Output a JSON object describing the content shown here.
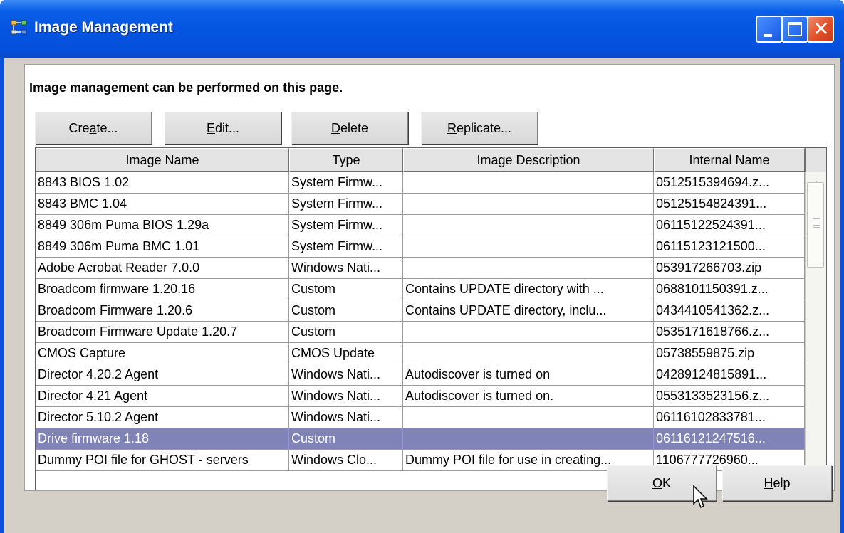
{
  "window": {
    "title": "Image Management"
  },
  "page": {
    "intro": "Image management can be performed on this page."
  },
  "toolbar": {
    "create": {
      "pre": "Cre",
      "mn": "a",
      "post": "te..."
    },
    "edit": {
      "pre": "",
      "mn": "E",
      "post": "dit..."
    },
    "delete": {
      "pre": "",
      "mn": "D",
      "post": "elete"
    },
    "replicate": {
      "pre": "",
      "mn": "R",
      "post": "eplicate..."
    }
  },
  "table": {
    "columns": [
      "Image Name",
      "Type",
      "Image Description",
      "Internal Name"
    ],
    "rows": [
      {
        "name": "8843 BIOS 1.02",
        "type": "System Firmw...",
        "desc": "",
        "internal": "0512515394694.z...",
        "selected": false
      },
      {
        "name": "8843 BMC 1.04",
        "type": "System Firmw...",
        "desc": "",
        "internal": "05125154824391...",
        "selected": false
      },
      {
        "name": "8849 306m Puma BIOS 1.29a",
        "type": "System Firmw...",
        "desc": "",
        "internal": "06115122524391...",
        "selected": false
      },
      {
        "name": "8849 306m Puma BMC 1.01",
        "type": "System Firmw...",
        "desc": "",
        "internal": "06115123121500...",
        "selected": false
      },
      {
        "name": "Adobe Acrobat Reader 7.0.0",
        "type": "Windows Nati...",
        "desc": "",
        "internal": "053917266703.zip",
        "selected": false
      },
      {
        "name": "Broadcom firmware 1.20.16",
        "type": "Custom",
        "desc": "Contains UPDATE directory with ...",
        "internal": "0688101150391.z...",
        "selected": false
      },
      {
        "name": "Broadcom Firmware 1.20.6",
        "type": "Custom",
        "desc": "Contains UPDATE directory, inclu...",
        "internal": "0434410541362.z...",
        "selected": false
      },
      {
        "name": "Broadcom Firmware Update 1.20.7",
        "type": "Custom",
        "desc": "",
        "internal": "0535171618766.z...",
        "selected": false
      },
      {
        "name": "CMOS Capture",
        "type": "CMOS Update",
        "desc": "",
        "internal": "05738559875.zip",
        "selected": false
      },
      {
        "name": "Director 4.20.2 Agent",
        "type": "Windows Nati...",
        "desc": "Autodiscover is turned on",
        "internal": "04289124815891...",
        "selected": false
      },
      {
        "name": "Director 4.21 Agent",
        "type": "Windows Nati...",
        "desc": "Autodiscover is turned on.",
        "internal": "0553133523156.z...",
        "selected": false
      },
      {
        "name": "Director 5.10.2 Agent",
        "type": "Windows Nati...",
        "desc": "",
        "internal": "06116102833781...",
        "selected": false
      },
      {
        "name": "Drive firmware 1.18",
        "type": "Custom",
        "desc": "",
        "internal": "06116121247516...",
        "selected": true
      },
      {
        "name": "Dummy POI file for GHOST - servers",
        "type": "Windows Clo...",
        "desc": "Dummy POI file for use in creating...",
        "internal": "1106777726960...",
        "selected": false
      }
    ]
  },
  "footer": {
    "ok": {
      "pre": "",
      "mn": "O",
      "post": "K"
    },
    "help": {
      "pre": "",
      "mn": "H",
      "post": "elp"
    }
  },
  "colors": {
    "titlebar": "#0455e0",
    "selection": "#8083b8",
    "dialog_bg": "#d4d0c8"
  },
  "icons": {
    "window": "tree-network-icon",
    "minimize": "minimize-icon",
    "maximize": "maximize-icon",
    "close": "close-icon",
    "scroll_up": "arrow-up-icon",
    "scroll_down": "arrow-down-icon",
    "cursor": "mouse-pointer-icon"
  }
}
